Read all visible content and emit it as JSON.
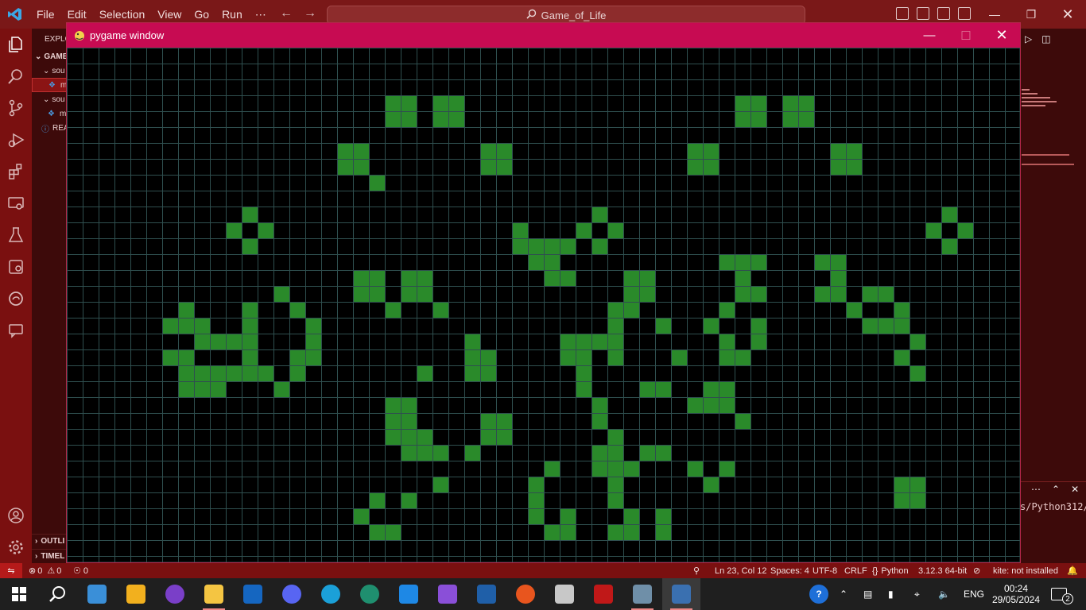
{
  "vscode": {
    "menu": [
      "File",
      "Edit",
      "Selection",
      "View",
      "Go",
      "Run",
      "⋯"
    ],
    "search_text": "Game_of_Life",
    "sidebar": {
      "explorer": "EXPLO",
      "game": "GAME",
      "sou1": "sou",
      "file1": "m",
      "sou2": "sou",
      "file2": "m",
      "readme": "REA",
      "outline": "OUTLI",
      "timeline": "TIMEL"
    },
    "right": {
      "path_text": "s/Python312/p"
    }
  },
  "pygame": {
    "title": "pygame window",
    "grid": {
      "cols": 60,
      "rows": 33,
      "cell_color": "#2a8a2a",
      "line_color": "#2f4f4f",
      "background": "#000000",
      "live": [
        [
          20,
          3
        ],
        [
          21,
          3
        ],
        [
          23,
          3
        ],
        [
          24,
          3
        ],
        [
          42,
          3
        ],
        [
          43,
          3
        ],
        [
          45,
          3
        ],
        [
          46,
          3
        ],
        [
          20,
          4
        ],
        [
          21,
          4
        ],
        [
          23,
          4
        ],
        [
          24,
          4
        ],
        [
          42,
          4
        ],
        [
          43,
          4
        ],
        [
          45,
          4
        ],
        [
          46,
          4
        ],
        [
          17,
          6
        ],
        [
          18,
          6
        ],
        [
          26,
          6
        ],
        [
          27,
          6
        ],
        [
          39,
          6
        ],
        [
          40,
          6
        ],
        [
          48,
          6
        ],
        [
          49,
          6
        ],
        [
          17,
          7
        ],
        [
          18,
          7
        ],
        [
          26,
          7
        ],
        [
          27,
          7
        ],
        [
          39,
          7
        ],
        [
          40,
          7
        ],
        [
          48,
          7
        ],
        [
          49,
          7
        ],
        [
          19,
          8
        ],
        [
          11,
          10
        ],
        [
          33,
          10
        ],
        [
          55,
          10
        ],
        [
          10,
          11
        ],
        [
          12,
          11
        ],
        [
          28,
          11
        ],
        [
          32,
          11
        ],
        [
          34,
          11
        ],
        [
          54,
          11
        ],
        [
          56,
          11
        ],
        [
          11,
          12
        ],
        [
          28,
          12
        ],
        [
          29,
          12
        ],
        [
          30,
          12
        ],
        [
          31,
          12
        ],
        [
          33,
          12
        ],
        [
          55,
          12
        ],
        [
          29,
          13
        ],
        [
          30,
          13
        ],
        [
          41,
          13
        ],
        [
          42,
          13
        ],
        [
          43,
          13
        ],
        [
          47,
          13
        ],
        [
          48,
          13
        ],
        [
          18,
          14
        ],
        [
          19,
          14
        ],
        [
          21,
          14
        ],
        [
          22,
          14
        ],
        [
          30,
          14
        ],
        [
          31,
          14
        ],
        [
          35,
          14
        ],
        [
          36,
          14
        ],
        [
          42,
          14
        ],
        [
          48,
          14
        ],
        [
          13,
          15
        ],
        [
          18,
          15
        ],
        [
          19,
          15
        ],
        [
          21,
          15
        ],
        [
          22,
          15
        ],
        [
          35,
          15
        ],
        [
          36,
          15
        ],
        [
          42,
          15
        ],
        [
          43,
          15
        ],
        [
          47,
          15
        ],
        [
          48,
          15
        ],
        [
          50,
          15
        ],
        [
          51,
          15
        ],
        [
          7,
          16
        ],
        [
          11,
          16
        ],
        [
          14,
          16
        ],
        [
          20,
          16
        ],
        [
          23,
          16
        ],
        [
          34,
          16
        ],
        [
          35,
          16
        ],
        [
          41,
          16
        ],
        [
          49,
          16
        ],
        [
          52,
          16
        ],
        [
          6,
          17
        ],
        [
          7,
          17
        ],
        [
          8,
          17
        ],
        [
          11,
          17
        ],
        [
          15,
          17
        ],
        [
          34,
          17
        ],
        [
          37,
          17
        ],
        [
          40,
          17
        ],
        [
          43,
          17
        ],
        [
          50,
          17
        ],
        [
          51,
          17
        ],
        [
          52,
          17
        ],
        [
          8,
          18
        ],
        [
          9,
          18
        ],
        [
          10,
          18
        ],
        [
          11,
          18
        ],
        [
          15,
          18
        ],
        [
          25,
          18
        ],
        [
          31,
          18
        ],
        [
          32,
          18
        ],
        [
          33,
          18
        ],
        [
          34,
          18
        ],
        [
          41,
          18
        ],
        [
          43,
          18
        ],
        [
          53,
          18
        ],
        [
          6,
          19
        ],
        [
          7,
          19
        ],
        [
          11,
          19
        ],
        [
          14,
          19
        ],
        [
          15,
          19
        ],
        [
          25,
          19
        ],
        [
          26,
          19
        ],
        [
          31,
          19
        ],
        [
          32,
          19
        ],
        [
          34,
          19
        ],
        [
          38,
          19
        ],
        [
          41,
          19
        ],
        [
          42,
          19
        ],
        [
          52,
          19
        ],
        [
          7,
          20
        ],
        [
          8,
          20
        ],
        [
          9,
          20
        ],
        [
          10,
          20
        ],
        [
          11,
          20
        ],
        [
          12,
          20
        ],
        [
          14,
          20
        ],
        [
          22,
          20
        ],
        [
          25,
          20
        ],
        [
          26,
          20
        ],
        [
          32,
          20
        ],
        [
          53,
          20
        ],
        [
          7,
          21
        ],
        [
          8,
          21
        ],
        [
          9,
          21
        ],
        [
          13,
          21
        ],
        [
          32,
          21
        ],
        [
          36,
          21
        ],
        [
          37,
          21
        ],
        [
          40,
          21
        ],
        [
          41,
          21
        ],
        [
          20,
          22
        ],
        [
          21,
          22
        ],
        [
          33,
          22
        ],
        [
          39,
          22
        ],
        [
          40,
          22
        ],
        [
          41,
          22
        ],
        [
          20,
          23
        ],
        [
          21,
          23
        ],
        [
          26,
          23
        ],
        [
          27,
          23
        ],
        [
          33,
          23
        ],
        [
          42,
          23
        ],
        [
          20,
          24
        ],
        [
          21,
          24
        ],
        [
          22,
          24
        ],
        [
          26,
          24
        ],
        [
          27,
          24
        ],
        [
          34,
          24
        ],
        [
          21,
          25
        ],
        [
          22,
          25
        ],
        [
          23,
          25
        ],
        [
          25,
          25
        ],
        [
          33,
          25
        ],
        [
          34,
          25
        ],
        [
          36,
          25
        ],
        [
          37,
          25
        ],
        [
          30,
          26
        ],
        [
          33,
          26
        ],
        [
          34,
          26
        ],
        [
          35,
          26
        ],
        [
          39,
          26
        ],
        [
          41,
          26
        ],
        [
          23,
          27
        ],
        [
          29,
          27
        ],
        [
          34,
          27
        ],
        [
          40,
          27
        ],
        [
          52,
          27
        ],
        [
          53,
          27
        ],
        [
          19,
          28
        ],
        [
          21,
          28
        ],
        [
          29,
          28
        ],
        [
          34,
          28
        ],
        [
          52,
          28
        ],
        [
          53,
          28
        ],
        [
          18,
          29
        ],
        [
          29,
          29
        ],
        [
          31,
          29
        ],
        [
          35,
          29
        ],
        [
          37,
          29
        ],
        [
          19,
          30
        ],
        [
          20,
          30
        ],
        [
          30,
          30
        ],
        [
          31,
          30
        ],
        [
          34,
          30
        ],
        [
          35,
          30
        ],
        [
          37,
          30
        ]
      ]
    }
  },
  "status": {
    "errors": "0",
    "warnings": "0",
    "ports": "0",
    "position": "Ln 23, Col 12",
    "spaces": "Spaces: 4",
    "encoding": "UTF-8",
    "eol": "CRLF",
    "language": "Python",
    "interpreter": "3.12.3 64-bit",
    "kite": "kite: not installed"
  },
  "taskbar": {
    "language": "ENG",
    "time": "00:24",
    "date": "29/05/2024",
    "notifications": "2",
    "apps": [
      "widgets",
      "store",
      "media-player",
      "file-explorer",
      "outlook",
      "discord",
      "edge",
      "edge-dev",
      "vscode",
      "visual-studio",
      "virtualbox",
      "ubuntu",
      "terminal",
      "filezilla",
      "image-app",
      "python"
    ],
    "app_colors": [
      "#3a8fd8",
      "#f2b01e",
      "#7a3fc8",
      "#f4c542",
      "#1566c0",
      "#5865f2",
      "#1ba0d8",
      "#1f8f6f",
      "#1e88e5",
      "#8a4fd8",
      "#1f5fa8",
      "#e8551e",
      "#c8c8c8",
      "#c01818",
      "#6f8fa8",
      "#3a70b0"
    ]
  }
}
